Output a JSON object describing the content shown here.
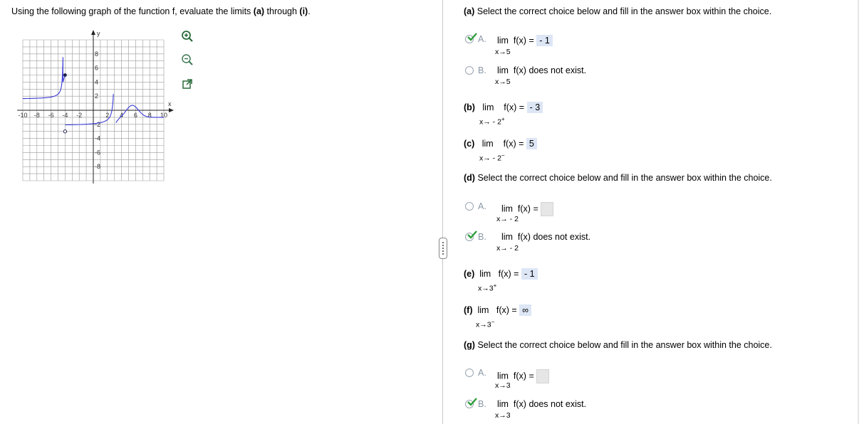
{
  "prompt": {
    "pre": "Using the following graph of the function f, evaluate the limits ",
    "a": "(a)",
    "mid": " through ",
    "i": "(i)",
    "end": "."
  },
  "graph": {
    "x_label": "x",
    "y_label": "y",
    "x_ticks": [
      "-10",
      "-8",
      "-6",
      "-4",
      "-2",
      "2",
      "4",
      "6",
      "8",
      "10"
    ],
    "y_ticks": [
      "8",
      "6",
      "4",
      "2",
      "-2",
      "-4",
      "-6",
      "-8"
    ],
    "curve_color": "#3c3cd8"
  },
  "tools": {
    "zoom_in": "zoom-in-icon",
    "zoom_out": "zoom-out-icon",
    "popout": "popout-icon"
  },
  "parts": {
    "a": {
      "label": "(a)",
      "text": " Select the correct choice below and fill in the answer box within the choice.",
      "A": {
        "letter": "A.",
        "lim": "lim",
        "fx": "f(x) =",
        "val": "- 1",
        "sub": "x→5"
      },
      "B": {
        "letter": "B.",
        "lim": "lim",
        "fx": "f(x) does not exist.",
        "sub": "x→5"
      }
    },
    "b": {
      "label": "(b)",
      "lim": "lim",
      "fx": "f(x) =",
      "val": "- 3",
      "sub": "x→ - 2",
      "sup": "+"
    },
    "c": {
      "label": "(c)",
      "lim": "lim",
      "fx": "f(x) =",
      "val": "5",
      "sub": "x→ - 2",
      "sup": "−"
    },
    "d": {
      "label": "(d)",
      "text": " Select the correct choice below and fill in the answer box within the choice.",
      "A": {
        "letter": "A.",
        "lim": "lim",
        "fx": "f(x) =",
        "sub": "x→ - 2"
      },
      "B": {
        "letter": "B.",
        "lim": "lim",
        "fx": "f(x) does not exist.",
        "sub": "x→ - 2"
      }
    },
    "e": {
      "label": "(e)",
      "lim": "lim",
      "fx": "f(x) =",
      "val": "- 1",
      "sub": "x→3",
      "sup": "+"
    },
    "f": {
      "label": "(f)",
      "lim": "lim",
      "fx": "f(x) =",
      "val": "∞",
      "sub": "x→3",
      "sup": "−"
    },
    "g": {
      "label": "(g)",
      "text": " Select the correct choice below and fill in the answer box within the choice.",
      "A": {
        "letter": "A.",
        "lim": "lim",
        "fx": "f(x) =",
        "sub": "x→3"
      },
      "B": {
        "letter": "B.",
        "lim": "lim",
        "fx": "f(x) does not exist.",
        "sub": "x→3"
      }
    }
  },
  "colors": {
    "check": "#2e9e3c",
    "answer_bg": "#dde6f5",
    "letter": "#8a97a6"
  }
}
